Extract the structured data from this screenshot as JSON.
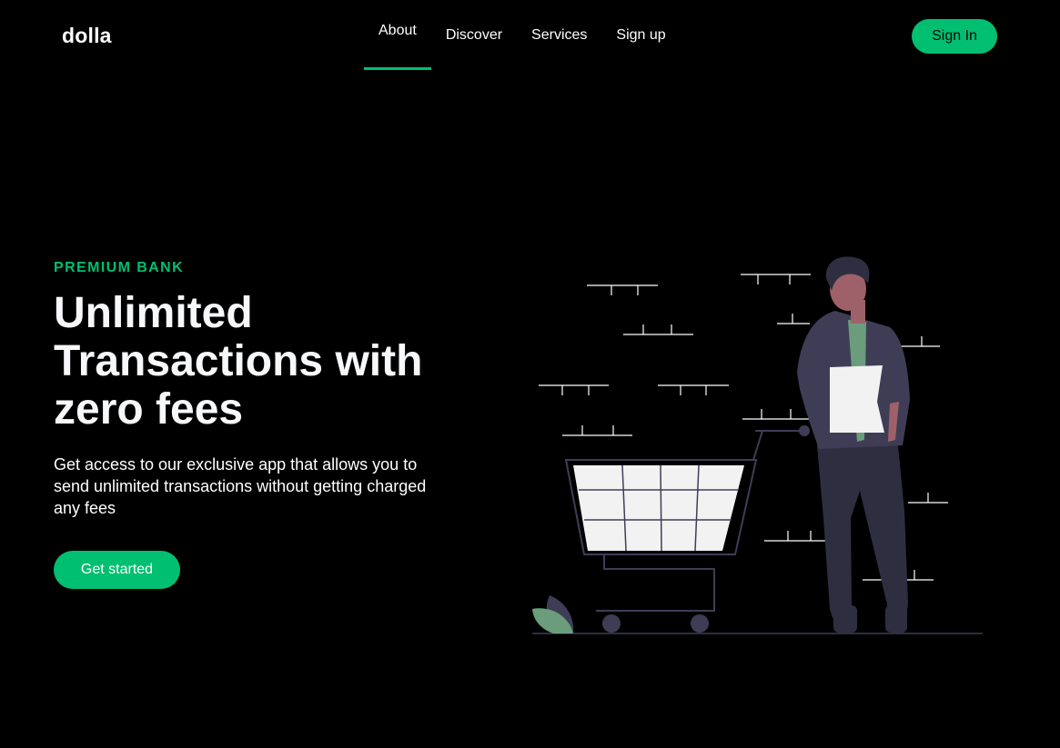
{
  "nav": {
    "logo": "dolla",
    "items": [
      {
        "label": "About",
        "active": true
      },
      {
        "label": "Discover",
        "active": false
      },
      {
        "label": "Services",
        "active": false
      },
      {
        "label": "Sign up",
        "active": false
      }
    ],
    "signin_label": "Sign In"
  },
  "hero": {
    "top_line": "PREMIUM BANK",
    "heading": "Unlimited Transactions with zero fees",
    "subtitle": "Get access to our exclusive app that allows you to send unlimited transactions without getting charged any fees",
    "cta_label": "Get started"
  },
  "colors": {
    "background": "#000000",
    "accent": "#01bf71",
    "text": "#ffffff"
  }
}
